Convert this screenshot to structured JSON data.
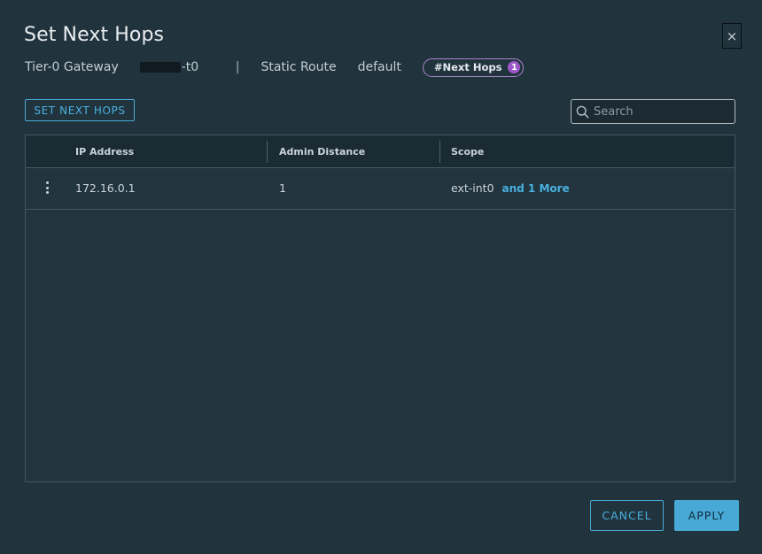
{
  "dialog": {
    "title": "Set Next Hops",
    "close_glyph": "×"
  },
  "subheader": {
    "gateway_label": "Tier-0 Gateway",
    "gateway_name_suffix": "-t0",
    "separator": "|",
    "route_label": "Static Route",
    "route_name": "default",
    "pill_label": "#Next Hops",
    "pill_count": "1"
  },
  "toolbar": {
    "set_next_hops_label": "SET NEXT HOPS",
    "search_placeholder": "Search",
    "search_icon": "search-icon"
  },
  "table": {
    "columns": [
      "IP Address",
      "Admin Distance",
      "Scope"
    ],
    "rows": [
      {
        "ip": "172.16.0.1",
        "admin_distance": "1",
        "scope": "ext-int0",
        "scope_more": "and 1 More",
        "actions_icon": "kebab-menu-icon"
      }
    ]
  },
  "footer": {
    "cancel_label": "CANCEL",
    "apply_label": "APPLY"
  },
  "colors": {
    "background": "#21333d",
    "accent": "#49a9d6",
    "pill_border": "#a886c9",
    "pill_badge": "#9e57c8"
  }
}
